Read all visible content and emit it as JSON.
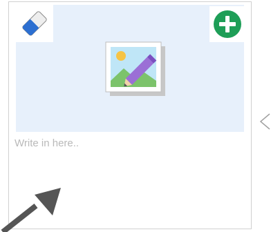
{
  "card": {
    "text_placeholder": "Write in here..",
    "text_value": "",
    "buttons": {
      "eraser_icon": "eraser-icon",
      "add_icon": "plus-circle-icon",
      "add_color": "#1e9e57"
    },
    "image_icon": "image-edit-icon",
    "image_area_color": "#e7f0fb"
  },
  "navigation": {
    "prev_icon": "chevron-left-icon"
  },
  "cursor": {
    "icon": "arrow-cursor-icon"
  }
}
